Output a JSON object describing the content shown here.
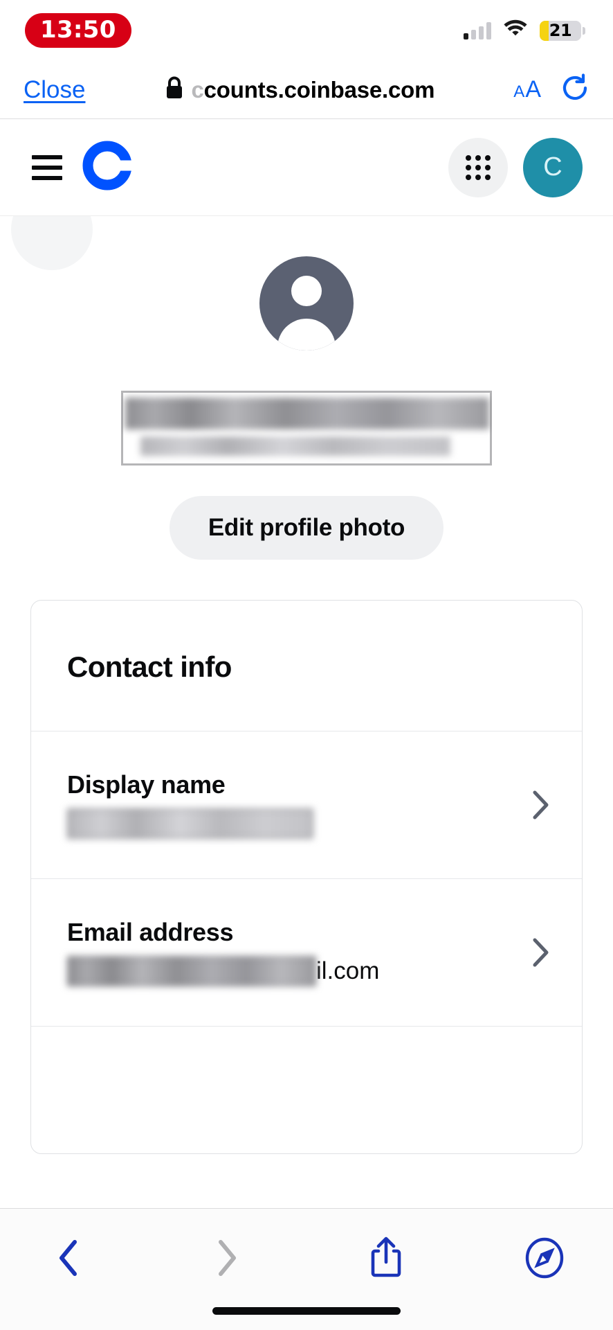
{
  "status_bar": {
    "time": "13:50",
    "battery_level": "21",
    "battery_percent": 21,
    "battery_color": "#f5d312",
    "signal_bars_total": 4,
    "signal_bars_active": 1,
    "wifi_icon": "wifi-icon",
    "cellular_icon": "cellular-signal-icon",
    "battery_icon": "battery-icon"
  },
  "browser": {
    "close_label": "Close",
    "lock_icon": "lock-icon",
    "url_truncated_prefix": "c",
    "url": "counts.coinbase.com",
    "url_full_visible": "ccounts.coinbase.com",
    "text_size_small": "A",
    "text_size_large": "A",
    "reload_icon": "reload-icon",
    "toolbar": {
      "back_icon": "chevron-left-icon",
      "forward_icon": "chevron-right-icon",
      "share_icon": "share-icon",
      "tabs_icon": "safari-compass-icon",
      "back_enabled": true,
      "forward_enabled": false
    }
  },
  "site_header": {
    "menu_icon": "hamburger-menu-icon",
    "logo_icon": "coinbase-logo-icon",
    "logo_color": "#0052ff",
    "apps_icon": "grid-apps-icon",
    "avatar_initial": "C",
    "avatar_color": "#1f8fa8"
  },
  "profile": {
    "avatar_icon": "person-avatar-icon",
    "avatar_color": "#5b6172",
    "name_redacted": true,
    "email_redacted": true,
    "edit_photo_label": "Edit profile photo"
  },
  "contact_card": {
    "title": "Contact info",
    "rows": [
      {
        "label": "Display name",
        "value": "",
        "value_redacted": true,
        "value_suffix": "",
        "chevron_icon": "chevron-right-icon"
      },
      {
        "label": "Email address",
        "value": "",
        "value_redacted": true,
        "value_suffix": "il.com",
        "chevron_icon": "chevron-right-icon"
      }
    ]
  }
}
